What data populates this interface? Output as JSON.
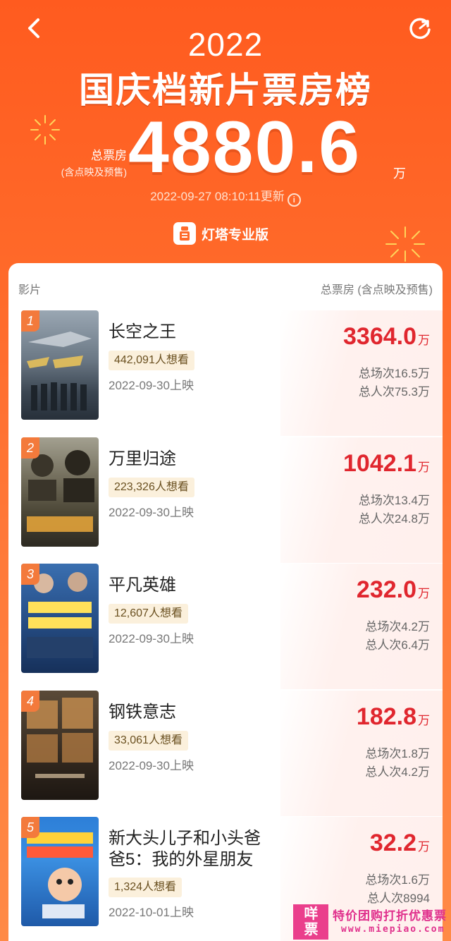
{
  "header": {
    "year": "2022",
    "title": "国庆档新片票房榜",
    "total_label": "总票房",
    "total_sub": "(含点映及预售)",
    "total_value": "4880.6",
    "total_unit": "万",
    "update_time": "2022-09-27 08:10:11更新",
    "brand": "灯塔专业版"
  },
  "table": {
    "col_film": "影片",
    "col_box": "总票房 (含点映及预售)"
  },
  "movies": [
    {
      "rank": "1",
      "title_l1": "长空之王",
      "title_l2": "",
      "want": "442,091人想看",
      "release": "2022-09-30上映",
      "box": "3364.0",
      "unit": "万",
      "shows": "总场次16.5万",
      "viewers": "总人次75.3万"
    },
    {
      "rank": "2",
      "title_l1": "万里归途",
      "title_l2": "",
      "want": "223,326人想看",
      "release": "2022-09-30上映",
      "box": "1042.1",
      "unit": "万",
      "shows": "总场次13.4万",
      "viewers": "总人次24.8万"
    },
    {
      "rank": "3",
      "title_l1": "平凡英雄",
      "title_l2": "",
      "want": "12,607人想看",
      "release": "2022-09-30上映",
      "box": "232.0",
      "unit": "万",
      "shows": "总场次4.2万",
      "viewers": "总人次6.4万"
    },
    {
      "rank": "4",
      "title_l1": "钢铁意志",
      "title_l2": "",
      "want": "33,061人想看",
      "release": "2022-09-30上映",
      "box": "182.8",
      "unit": "万",
      "shows": "总场次1.8万",
      "viewers": "总人次4.2万"
    },
    {
      "rank": "5",
      "title_l1": "新大头儿子和小头爸",
      "title_l2": "爸5：我的外星朋友",
      "want": "1,324人想看",
      "release": "2022-10-01上映",
      "box": "32.2",
      "unit": "万",
      "shows": "总场次1.6万",
      "viewers": "总人次8994"
    }
  ],
  "watermark": {
    "logo_l1": "咩",
    "logo_l2": "票",
    "slogan": "特价团购打折优惠票",
    "url": "www.miepiao.com"
  },
  "colors": {
    "accent": "#ff5b1f",
    "box_office_red": "#e0262e",
    "rank_badge": "#f37a3c",
    "want_badge_bg": "#fbf0dc"
  }
}
